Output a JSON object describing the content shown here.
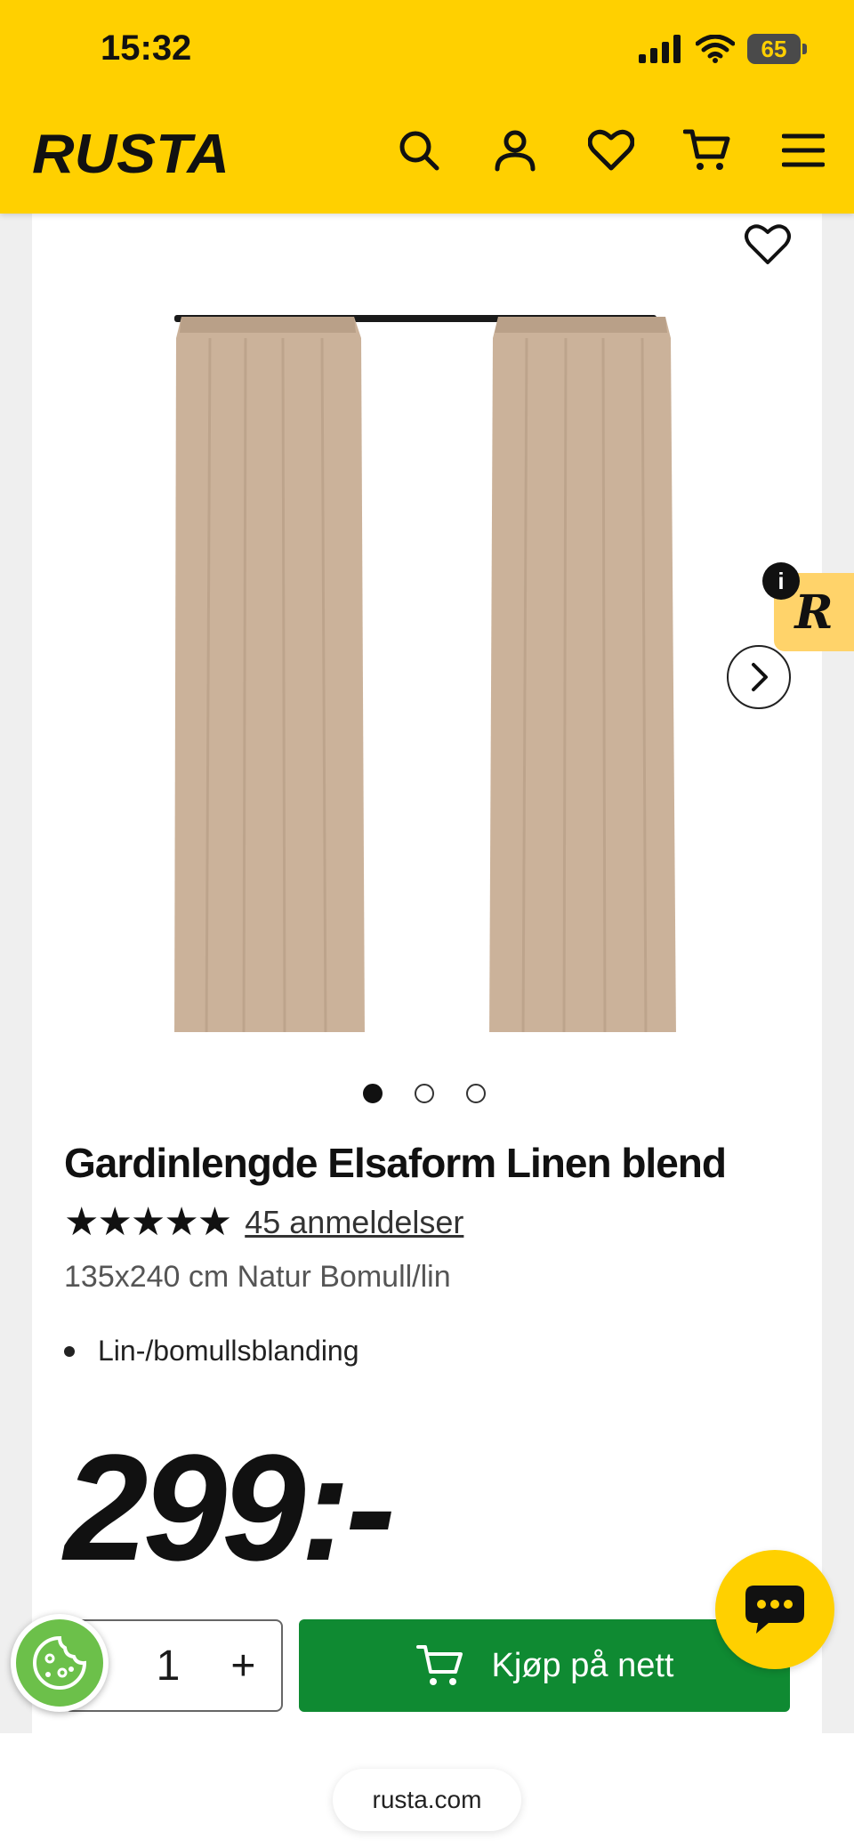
{
  "status": {
    "time": "15:32",
    "battery": "65"
  },
  "header": {
    "logo": "RUSTA"
  },
  "product": {
    "title": "Gardinlengde Elsaform Linen blend",
    "stars": "★★★★★",
    "reviews": "45 anmeldelser",
    "variant": "135x240 cm Natur Bomull/lin",
    "features": [
      "Lin-/bomullsblanding"
    ],
    "price": "299:-",
    "quantity": "1",
    "buy_label": "Kjøp på nett",
    "gallery_count": 3,
    "gallery_active": 1
  },
  "qty_controls": {
    "minus": "-",
    "plus": "+"
  },
  "widgets": {
    "info": "i",
    "r_badge": "R"
  },
  "browser": {
    "url": "rusta.com"
  },
  "colors": {
    "brand_yellow": "#ffd000",
    "buy_green": "#0f8a32",
    "cookie_green": "#6cc04a"
  }
}
